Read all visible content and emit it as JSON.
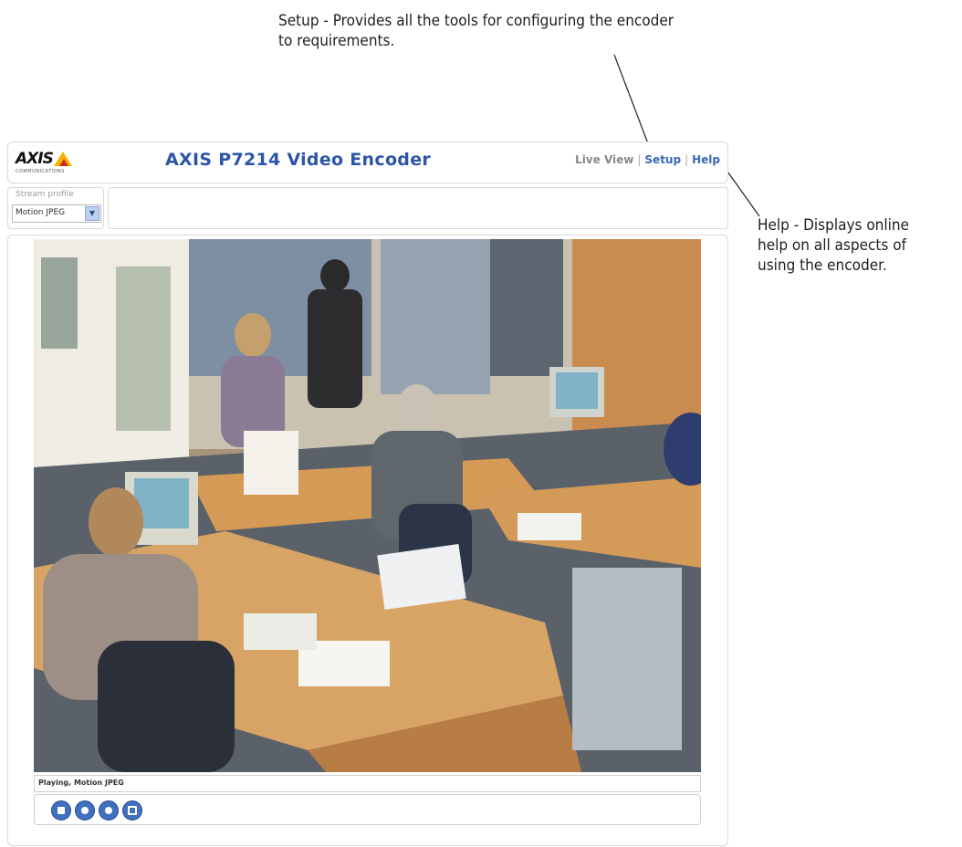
{
  "annotations": {
    "setup_callout": "Setup - Provides all the tools for configuring the encoder\nto requirements.",
    "help_callout": "Help - Displays online\nhelp on all aspects of\nusing the encoder."
  },
  "header": {
    "logo_text": "AXIS",
    "logo_subtext": "COMMUNICATIONS",
    "title": "AXIS P7214 Video Encoder",
    "nav": {
      "live_view": "Live View",
      "separator": "|",
      "setup": "Setup",
      "help": "Help"
    }
  },
  "stream_profile": {
    "label": "Stream profile",
    "selected": "Motion JPEG"
  },
  "status": {
    "text": "Playing, Motion JPEG"
  },
  "controls": {
    "buttons": [
      "stop-icon",
      "snapshot-icon",
      "record-icon",
      "fullscreen-icon"
    ]
  },
  "colors": {
    "title_blue": "#2c55a8",
    "link_blue": "#3a67b8",
    "button_blue": "#3f6fbf",
    "logo_yellow": "#f4b400",
    "logo_red": "#d32a1a"
  }
}
